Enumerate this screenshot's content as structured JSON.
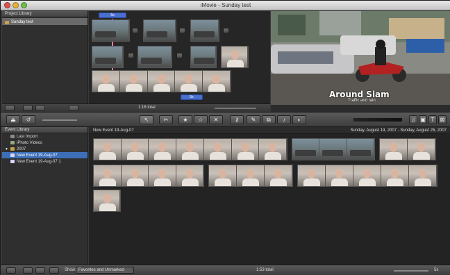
{
  "window": {
    "title": "iMovie - Sunday test"
  },
  "project_library": {
    "header": "Project Library",
    "items": [
      {
        "label": "Sunday test"
      }
    ]
  },
  "project": {
    "duration_badge_top": "5s",
    "duration_badge_bottom": "5s",
    "total": "1:16 total"
  },
  "viewer": {
    "title": "Around Siam",
    "subtitle": "Traffic and rain"
  },
  "event_library": {
    "header": "Event Library",
    "items": [
      {
        "label": "Last Import",
        "icon": "film-icon"
      },
      {
        "label": "iPhoto Videos",
        "icon": "iphoto-icon"
      },
      {
        "label": "2007",
        "icon": "folder-icon"
      },
      {
        "label": "New Event 19-Aug-07",
        "icon": "event-icon"
      },
      {
        "label": "New Event 19-Aug-07 1",
        "icon": "event-icon"
      }
    ]
  },
  "event_browser": {
    "title": "New Event 19-Aug-07",
    "date_range": "Sunday, August 19, 2007 - Sunday, August 26, 2007"
  },
  "bottom": {
    "show_label": "Show:",
    "filter_value": "Favorites and Unmarked",
    "total": "1:53 total",
    "zoom_label": "5s"
  },
  "toolbar_icons": [
    "camera-import-icon",
    "undo-icon",
    "arrow-select-icon",
    "trim-icon",
    "favorite-star-icon",
    "unmark-star-icon",
    "reject-x-icon",
    "keyword-icon",
    "dropper-icon",
    "crop-icon",
    "audio-icon",
    "adjust-icon",
    "music-icon",
    "photo-icon",
    "title-icon",
    "transition-icon"
  ]
}
